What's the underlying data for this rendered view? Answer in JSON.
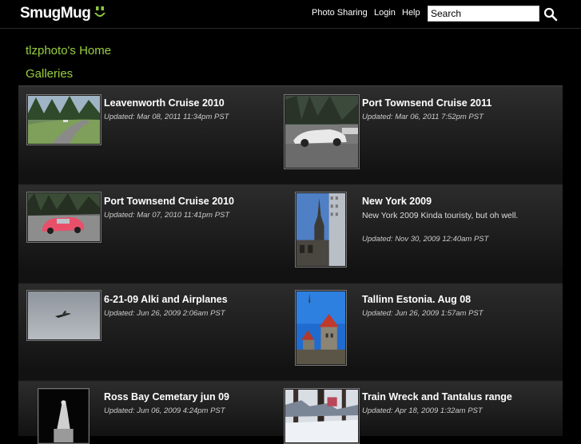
{
  "header": {
    "logo_text": "SmugMug",
    "nav": [
      "Photo Sharing",
      "Login",
      "Help"
    ],
    "search_placeholder": "Search"
  },
  "page": {
    "home_title": "tlzphoto's Home",
    "galleries_heading": "Galleries"
  },
  "galleries": [
    {
      "title": "Leavenworth Cruise 2010",
      "updated": "Updated: Mar 08, 2011 11:34pm PST"
    },
    {
      "title": "Port Townsend Cruise 2011",
      "updated": "Updated: Mar 06, 2011 7:52pm PST"
    },
    {
      "title": "Port Townsend Cruise 2010",
      "updated": "Updated: Mar 07, 2010 11:41pm PST"
    },
    {
      "title": "New York 2009",
      "description": "New York 2009 Kinda touristy, but oh well.",
      "updated": "Updated: Nov 30, 2009 12:40am PST"
    },
    {
      "title": "6-21-09 Alki and Airplanes",
      "updated": "Updated: Jun 26, 2009 2:06am PST"
    },
    {
      "title": "Tallinn Estonia. Aug 08",
      "updated": "Updated: Jun 26, 2009 1:57am PST"
    },
    {
      "title": "Ross Bay Cemetary jun 09",
      "updated": "Updated: Jun 06, 2009 4:24pm PST"
    },
    {
      "title": "Train Wreck and Tantalus range",
      "updated": "Updated: Apr 18, 2009 1:32am PST"
    }
  ],
  "colors": {
    "accent": "#9ad03f",
    "logo_smiley": "#8cc63f",
    "background": "#000000"
  }
}
